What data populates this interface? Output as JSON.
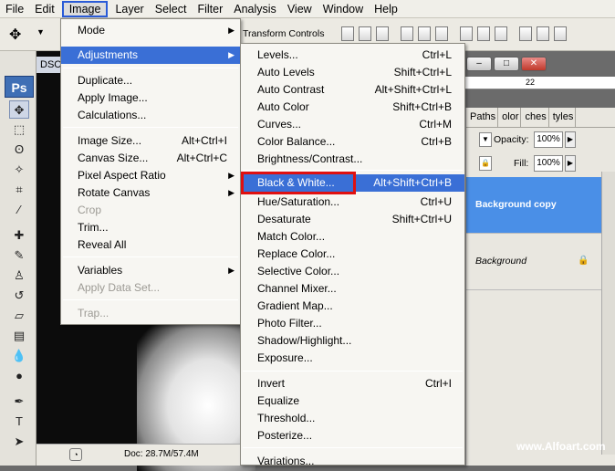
{
  "menubar": [
    "File",
    "Edit",
    "Image",
    "Layer",
    "Select",
    "Filter",
    "Analysis",
    "View",
    "Window",
    "Help"
  ],
  "optionsbar": {
    "transform_controls": "Transform Controls"
  },
  "toolbox": {
    "logo": "Ps"
  },
  "document": {
    "title": "DSC",
    "status_doc": "Doc: 28.7M/57.4M"
  },
  "ruler": {
    "mark": "22"
  },
  "layers": {
    "tabs": [
      "Paths",
      "olor",
      "ches",
      "tyles"
    ],
    "opacity_label": "Opacity:",
    "opacity_value": "100%",
    "fill_label": "Fill:",
    "fill_value": "100%",
    "items": [
      {
        "name": "Background copy"
      },
      {
        "name": "Background"
      }
    ]
  },
  "image_menu": {
    "items": [
      {
        "label": "Mode",
        "submenu": true
      },
      {
        "label": "Adjustments",
        "submenu": true,
        "highlighted": true
      },
      {
        "label": "Duplicate..."
      },
      {
        "label": "Apply Image..."
      },
      {
        "label": "Calculations..."
      },
      {
        "label": "Image Size...",
        "shortcut": "Alt+Ctrl+I"
      },
      {
        "label": "Canvas Size...",
        "shortcut": "Alt+Ctrl+C"
      },
      {
        "label": "Pixel Aspect Ratio",
        "submenu": true
      },
      {
        "label": "Rotate Canvas",
        "submenu": true
      },
      {
        "label": "Crop",
        "disabled": true
      },
      {
        "label": "Trim..."
      },
      {
        "label": "Reveal All"
      },
      {
        "label": "Variables",
        "submenu": true
      },
      {
        "label": "Apply Data Set...",
        "disabled": true
      },
      {
        "label": "Trap...",
        "disabled": true
      }
    ]
  },
  "adjustments_menu": {
    "items": [
      {
        "label": "Levels...",
        "shortcut": "Ctrl+L"
      },
      {
        "label": "Auto Levels",
        "shortcut": "Shift+Ctrl+L"
      },
      {
        "label": "Auto Contrast",
        "shortcut": "Alt+Shift+Ctrl+L"
      },
      {
        "label": "Auto Color",
        "shortcut": "Shift+Ctrl+B"
      },
      {
        "label": "Curves...",
        "shortcut": "Ctrl+M"
      },
      {
        "label": "Color Balance...",
        "shortcut": "Ctrl+B"
      },
      {
        "label": "Brightness/Contrast..."
      },
      {
        "label": "Black & White...",
        "shortcut": "Alt+Shift+Ctrl+B",
        "highlighted": true
      },
      {
        "label": "Hue/Saturation...",
        "shortcut": "Ctrl+U"
      },
      {
        "label": "Desaturate",
        "shortcut": "Shift+Ctrl+U"
      },
      {
        "label": "Match Color..."
      },
      {
        "label": "Replace Color..."
      },
      {
        "label": "Selective Color..."
      },
      {
        "label": "Channel Mixer..."
      },
      {
        "label": "Gradient Map..."
      },
      {
        "label": "Photo Filter..."
      },
      {
        "label": "Shadow/Highlight..."
      },
      {
        "label": "Exposure..."
      },
      {
        "label": "Invert",
        "shortcut": "Ctrl+I"
      },
      {
        "label": "Equalize"
      },
      {
        "label": "Threshold..."
      },
      {
        "label": "Posterize..."
      },
      {
        "label": "Variations..."
      }
    ]
  },
  "watermark": "www.Alfoart.com",
  "colors": {
    "highlight": "#3a6fd6",
    "annotation": "#e01010",
    "active_layer": "#4a8fe7"
  }
}
